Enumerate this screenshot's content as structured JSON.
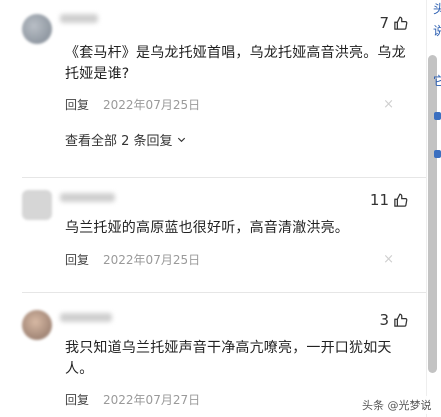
{
  "comments": [
    {
      "likes": "7",
      "text": "《套马杆》是乌龙托娅首唱，乌龙托娅高音洪亮。乌龙托娅是谁?",
      "reply_label": "回复",
      "date": "2022年07月25日",
      "close": "×",
      "view_all": "查看全部 2 条回复"
    },
    {
      "likes": "11",
      "text": "乌兰托娅的高原蓝也很好听，高音清澈洪亮。",
      "reply_label": "回复",
      "date": "2022年07月25日",
      "close": "×"
    },
    {
      "likes": "3",
      "text": "我只知道乌兰托娅声音干净高亢嘹亮，一开口犹如天人。",
      "reply_label": "回复",
      "date": "2022年07月27日",
      "close": "×"
    }
  ],
  "edge_chars": [
    "头",
    "说",
    "它"
  ],
  "watermark": "头条 @光梦说",
  "colors": {
    "accent": "#2a5db0",
    "meta": "#9a9a9a",
    "scrollbar": "#c3c3c3"
  },
  "icons": {
    "like": "thumbs-up-icon",
    "chevron": "chevron-down-icon",
    "close": "close-icon"
  }
}
